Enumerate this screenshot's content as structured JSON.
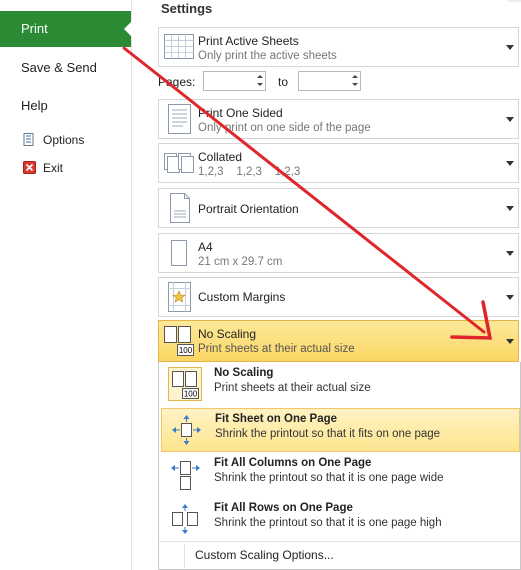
{
  "nav": {
    "print": "Print",
    "save_send": "Save & Send",
    "help": "Help",
    "options": "Options",
    "exit": "Exit"
  },
  "settings": {
    "title": "Settings",
    "print_what": {
      "title": "Print Active Sheets",
      "subtitle": "Only print the active sheets"
    },
    "pages": {
      "label": "Pages:",
      "from_value": "",
      "to_label": "to",
      "to_value": ""
    },
    "sides": {
      "title": "Print One Sided",
      "subtitle": "Only print on one side of the page"
    },
    "collation": {
      "title": "Collated",
      "subtitle": "1,2,3    1,2,3    1,2,3"
    },
    "orientation": {
      "title": "Portrait Orientation"
    },
    "paper": {
      "title": "A4",
      "subtitle": "21 cm x 29.7 cm"
    },
    "margins": {
      "title": "Custom Margins"
    },
    "scaling": {
      "title": "No Scaling",
      "subtitle": "Print sheets at their actual size"
    }
  },
  "scaling_menu": {
    "items": [
      {
        "title": "No Scaling",
        "subtitle": "Print sheets at their actual size"
      },
      {
        "title": "Fit Sheet on One Page",
        "subtitle": "Shrink the printout so that it fits on one page"
      },
      {
        "title": "Fit All Columns on One Page",
        "subtitle": "Shrink the printout so that it is one page wide"
      },
      {
        "title": "Fit All Rows on One Page",
        "subtitle": "Shrink the printout so that it is one page high"
      }
    ],
    "custom": "Custom Scaling Options..."
  },
  "icon_text": {
    "hundred": "100",
    "hundred_menu": "100"
  },
  "colors": {
    "print_tab": "#2b8a34",
    "highlight": "#fde58f",
    "annotation_arrow": "#e0262b"
  }
}
